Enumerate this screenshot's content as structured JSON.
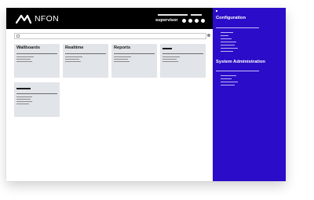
{
  "app": {
    "brand_name": "NFON",
    "user_role": "supervisor",
    "accent_color": "#2b0cc8",
    "header_color": "#000000"
  },
  "toolbar": {
    "search_icon": "search-icon",
    "settings_icon": "gear-icon"
  },
  "cards": [
    {
      "title": "Wallboards"
    },
    {
      "title": "Realtime"
    },
    {
      "title": "Reports"
    },
    {
      "title": ""
    },
    {
      "title": ""
    }
  ],
  "sidebar": {
    "sections": [
      {
        "heading": "Configuration"
      },
      {
        "heading": "System Administration"
      }
    ]
  }
}
